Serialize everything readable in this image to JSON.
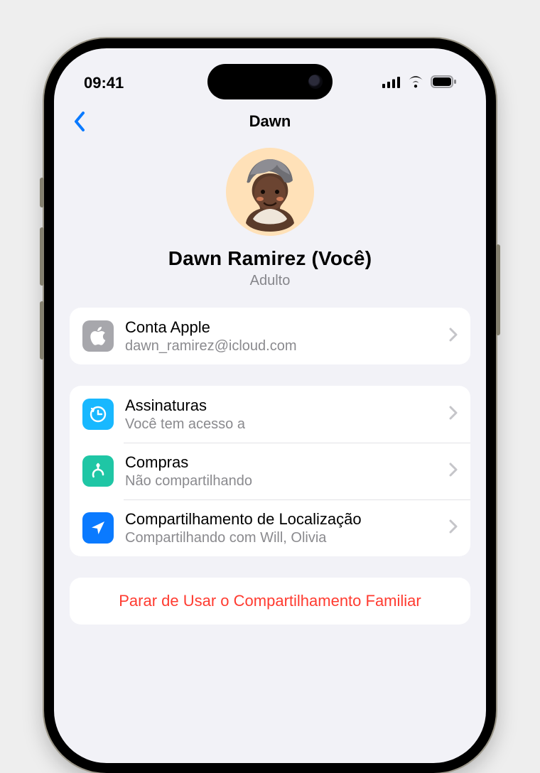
{
  "status": {
    "time": "09:41"
  },
  "nav": {
    "title": "Dawn"
  },
  "profile": {
    "name": "Dawn Ramirez (Você)",
    "role": "Adulto"
  },
  "account": {
    "title": "Conta Apple",
    "subtitle": "dawn_ramirez@icloud.com"
  },
  "items": [
    {
      "title": "Assinaturas",
      "subtitle": "Você tem acesso a"
    },
    {
      "title": "Compras",
      "subtitle": "Não compartilhando"
    },
    {
      "title": "Compartilhamento de Localização",
      "subtitle": "Compartilhando com Will, Olivia"
    }
  ],
  "danger": {
    "label": "Parar de Usar o Compartilhamento Familiar"
  }
}
